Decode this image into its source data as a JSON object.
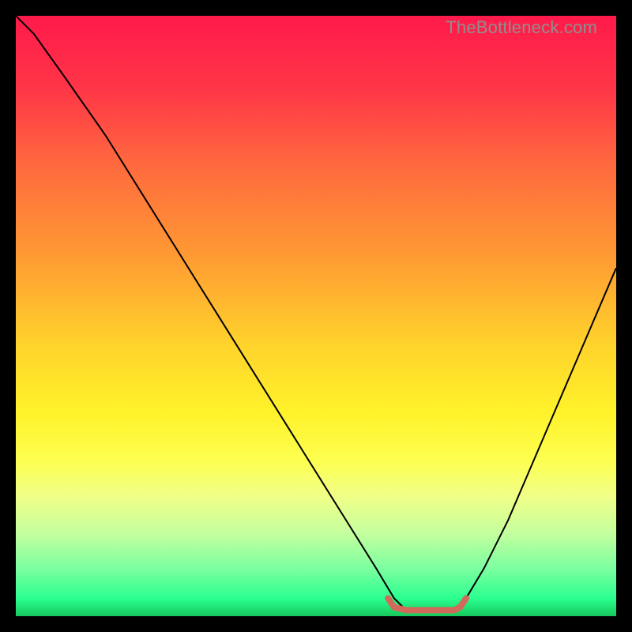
{
  "watermark": "TheBottleneck.com",
  "chart_data": {
    "type": "line",
    "title": "",
    "xlabel": "",
    "ylabel": "",
    "xlim": [
      0,
      100
    ],
    "ylim": [
      0,
      100
    ],
    "background_gradient": {
      "stops": [
        {
          "offset": 0,
          "color": "#ff1a4b"
        },
        {
          "offset": 12,
          "color": "#ff3547"
        },
        {
          "offset": 25,
          "color": "#ff6a3e"
        },
        {
          "offset": 40,
          "color": "#ff9a33"
        },
        {
          "offset": 55,
          "color": "#ffd42b"
        },
        {
          "offset": 66,
          "color": "#fff22a"
        },
        {
          "offset": 74,
          "color": "#fdff4f"
        },
        {
          "offset": 80,
          "color": "#f0ff87"
        },
        {
          "offset": 86,
          "color": "#c6ff9e"
        },
        {
          "offset": 92,
          "color": "#7dffa0"
        },
        {
          "offset": 97,
          "color": "#2bff8f"
        },
        {
          "offset": 100,
          "color": "#16c95d"
        }
      ]
    },
    "series": [
      {
        "name": "bottleneck-curve",
        "color": "#000000",
        "stroke_width": 2,
        "x": [
          0,
          3,
          8,
          15,
          25,
          35,
          45,
          55,
          60,
          63,
          65,
          70,
          73,
          75,
          78,
          82,
          88,
          94,
          100
        ],
        "values": [
          100,
          97,
          90,
          80,
          64,
          48,
          32,
          16,
          8,
          3,
          1,
          1,
          1,
          3,
          8,
          16,
          30,
          44,
          58
        ]
      }
    ],
    "markers": [
      {
        "name": "optimal-flat-region",
        "color": "#d16a5a",
        "stroke_width": 8,
        "x": [
          62,
          63,
          65,
          70,
          73,
          74,
          75
        ],
        "values": [
          3,
          1.5,
          1,
          1,
          1,
          1.5,
          3
        ]
      }
    ]
  }
}
